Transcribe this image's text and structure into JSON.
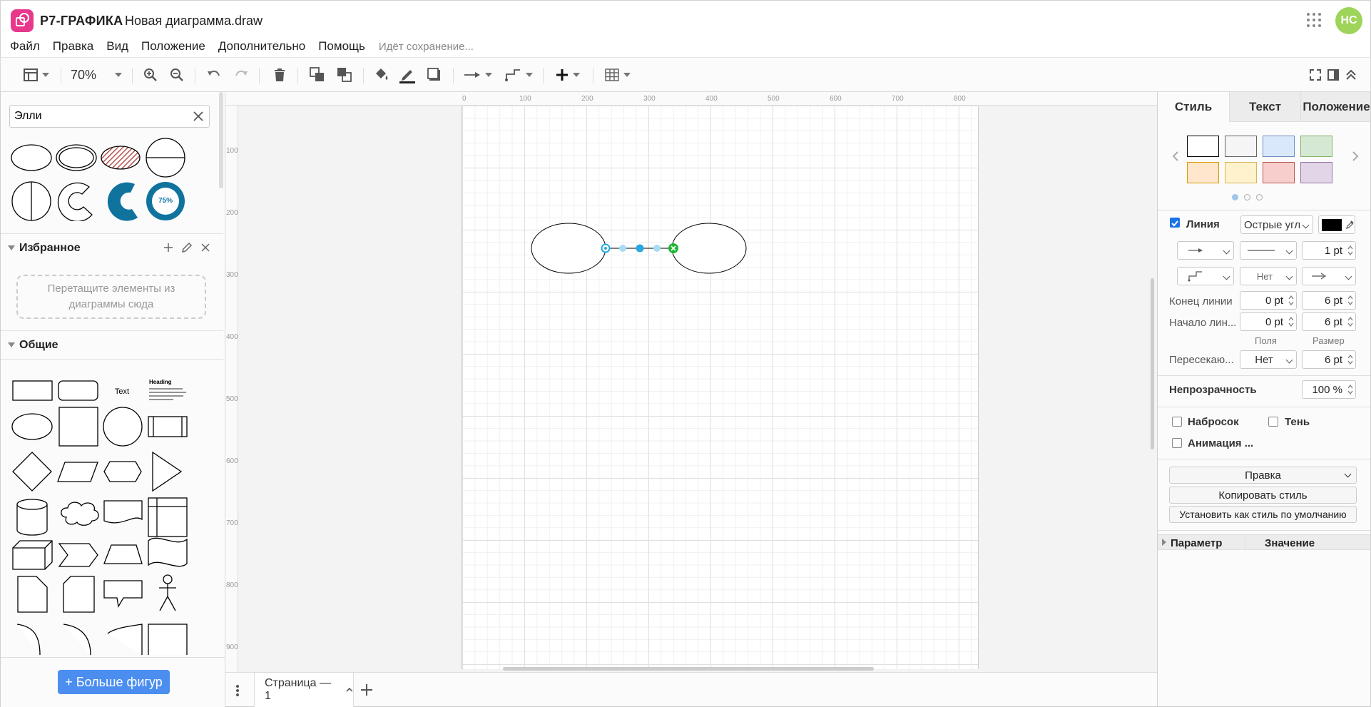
{
  "app": {
    "name": "Р7-ГРАФИКА",
    "document": "Новая диаграмма.draw",
    "user_initials": "НС",
    "accent": "#e8388c",
    "avatar_color": "#9ed45a"
  },
  "menu": {
    "items": [
      "Файл",
      "Правка",
      "Вид",
      "Положение",
      "Дополнительно",
      "Помощь"
    ],
    "status": "Идёт сохранение..."
  },
  "toolbar": {
    "zoom": "70%"
  },
  "left_panel": {
    "search": {
      "value": "Элли",
      "placeholder": ""
    },
    "search_results": [
      "ellipse",
      "double-ellipse",
      "hatched-ellipse",
      "circle-half-horizontal",
      "circle-half-vertical",
      "arc",
      "donut-arc",
      "progress-donut"
    ],
    "progress_label": "75%",
    "favorites": {
      "title": "Избранное",
      "drop_text": "Перетащите элементы из диаграммы сюда"
    },
    "general": {
      "title": "Общие",
      "text_label": "Text",
      "heading_label": "Heading"
    },
    "more_shapes": "+ Больше фигур"
  },
  "rulers": {
    "top": [
      "0",
      "100",
      "200",
      "300",
      "400",
      "500",
      "600",
      "700",
      "800"
    ],
    "left": [
      "100",
      "200",
      "300",
      "400",
      "500",
      "600",
      "700",
      "800",
      "900"
    ]
  },
  "pages": {
    "current": "Страница — 1"
  },
  "right_panel": {
    "tabs": [
      "Стиль",
      "Текст",
      "Положение"
    ],
    "swatches": [
      "#ffffff",
      "#f5f5f5",
      "#dae8fc",
      "#d5e8d4",
      "#ffe6cc",
      "#fff2cc",
      "#f8cecc",
      "#e1d5e7"
    ],
    "swatch_borders": [
      "#000000",
      "#666666",
      "#6c8ebf",
      "#82b366",
      "#d79b00",
      "#d6b656",
      "#b85450",
      "#9673a6"
    ],
    "line": {
      "label": "Линия",
      "checked": true,
      "style": "Острые угл",
      "color": "#000000",
      "width": "1 pt",
      "waypoint": "Нет"
    },
    "line_end": {
      "label": "Конец линии",
      "spacing": "0 pt",
      "size": "6 pt"
    },
    "line_start": {
      "label": "Начало лин...",
      "spacing": "0 pt",
      "size": "6 pt"
    },
    "columns": {
      "spacing": "Поля",
      "size": "Размер"
    },
    "crossings": {
      "label": "Пересекаю...",
      "value": "Нет",
      "size": "6 pt"
    },
    "opacity": {
      "label": "Непрозрачность",
      "value": "100 %"
    },
    "options": {
      "sketch": "Набросок",
      "shadow": "Тень",
      "animation": "Анимация ..."
    },
    "edit_select": "Правка",
    "copy_style": "Копировать стиль",
    "set_default": "Установить как стиль по умолчанию",
    "props": {
      "param": "Параметр",
      "value": "Значение"
    }
  }
}
